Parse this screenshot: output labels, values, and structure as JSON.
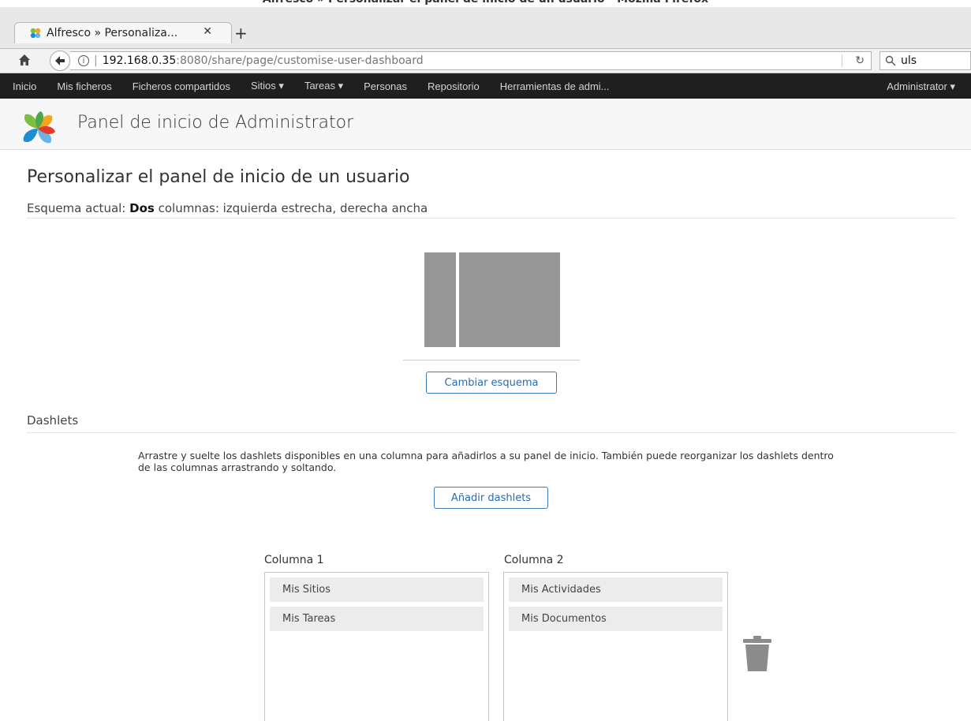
{
  "browser": {
    "window_title": "Alfresco » Personalizar el panel de inicio de un usuario - Mozilla Firefox",
    "tab_label": "Alfresco » Personaliza...",
    "tab_close": "✕",
    "new_tab": "+",
    "url_host": "192.168.0.35",
    "url_path": ":8080/share/page/customise-user-dashboard",
    "search_value": "uls"
  },
  "appnav": {
    "items": [
      "Inicio",
      "Mis ficheros",
      "Ficheros compartidos",
      "Sitios ▾",
      "Tareas ▾",
      "Personas",
      "Repositorio",
      "Herramientas de admi..."
    ],
    "user": "Administrator ▾"
  },
  "header": {
    "title": "Panel de inicio de Administrator"
  },
  "main": {
    "heading": "Personalizar el panel de inicio de un usuario",
    "layout_prefix": "Esquema actual: ",
    "layout_bold": "Dos",
    "layout_rest": " columnas: izquierda estrecha, derecha ancha",
    "change_layout_button": "Cambiar esquema",
    "dashlets_section": "Dashlets",
    "instructions": "Arrastre y suelte los dashlets disponibles en una columna para añadirlos a su panel de inicio. También puede reorganizar los dashlets dentro de las columnas arrastrando y soltando.",
    "add_dashlets_button": "Añadir dashlets",
    "columns": [
      {
        "label": "Columna 1",
        "dashlets": [
          "Mis Sitios",
          "Mis Tareas"
        ]
      },
      {
        "label": "Columna 2",
        "dashlets": [
          "Mis Actividades",
          "Mis Documentos"
        ]
      }
    ]
  },
  "icons": {
    "favicon": "alfresco-flower-icon",
    "home": "home-icon",
    "back": "back-arrow-icon",
    "info": "info-icon",
    "reload": "reload-icon",
    "search": "search-icon",
    "trash": "trash-icon"
  },
  "colors": {
    "appbar_bg": "#1f1f1f",
    "button_border": "#3e7ab3",
    "layout_preview": "#979797",
    "dashlet_bg": "#ececec"
  }
}
